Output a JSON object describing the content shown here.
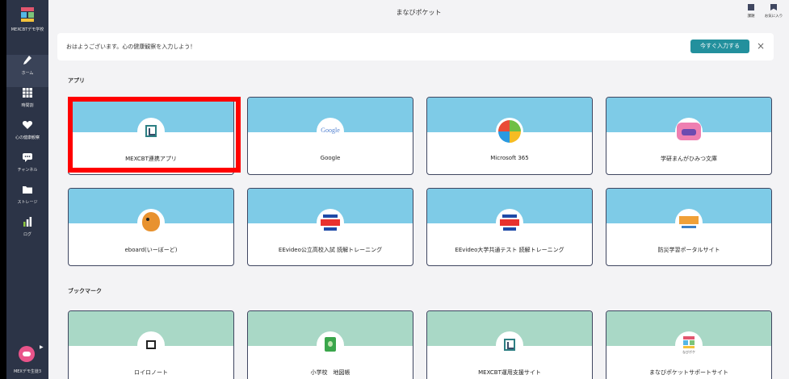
{
  "header": {
    "title": "まなびポケット",
    "buttons": [
      {
        "label": "課題",
        "icon": "document-icon"
      },
      {
        "label": "お気に入り",
        "icon": "bookmark-icon"
      }
    ]
  },
  "sidebar": {
    "school_name": "MEXCBTデモ学校",
    "items": [
      {
        "label": "ホーム",
        "icon": "pencil-icon"
      },
      {
        "label": "時間割",
        "icon": "timetable-icon"
      },
      {
        "label": "心の健康観察",
        "icon": "heart-icon"
      },
      {
        "label": "チャンネル",
        "icon": "chat-icon"
      },
      {
        "label": "ストレージ",
        "icon": "folder-icon"
      },
      {
        "label": "ログ",
        "icon": "bar-chart-icon"
      }
    ],
    "user": {
      "name": "MEXデモ生徒3"
    }
  },
  "notice": {
    "message": "おはようございます。心の健康観察を入力しよう！",
    "action_label": "今すぐ入力する",
    "close": "×"
  },
  "sections": {
    "apps_title": "アプリ",
    "bookmarks_title": "ブックマーク"
  },
  "apps": [
    {
      "label": "MEXCBT連携アプリ",
      "icon": "mexcbt-cube-icon",
      "selected": true
    },
    {
      "label": "Google",
      "icon": "google-logo-icon",
      "logo_text": "Google"
    },
    {
      "label": "Microsoft 365",
      "icon": "microsoft-365-icon"
    },
    {
      "label": "学研まんがひみつ文庫",
      "icon": "himitsu-bunko-icon"
    },
    {
      "label": "eboard(いーぼーど)",
      "icon": "eboard-bird-icon"
    },
    {
      "label": "EEvideo公立高校入試 読解トレーニング",
      "icon": "eevideo-koukou-icon"
    },
    {
      "label": "EEvideo大学共通テスト 読解トレーニング",
      "icon": "eevideo-daigaku-icon"
    },
    {
      "label": "防災学習ポータルサイト",
      "icon": "bousai-gakushu-icon"
    }
  ],
  "bookmarks": [
    {
      "label": "ロイロノート",
      "icon": "loilo-note-icon"
    },
    {
      "label": "小学校　地図帳",
      "icon": "atlas-icon"
    },
    {
      "label": "MEXCBT運用支援サイト",
      "icon": "mexcbt-cube-icon"
    },
    {
      "label": "まなびポケットサポートサイト",
      "icon": "manabi-pocket-logo-icon",
      "logo_text": "なびポケ"
    }
  ],
  "colors": {
    "sidebar": "#2c3447",
    "app_band": "#7ecbe7",
    "bookmark_band": "#a9d8c6",
    "accent": "#23909d",
    "selection_outline": "#ff0000"
  }
}
